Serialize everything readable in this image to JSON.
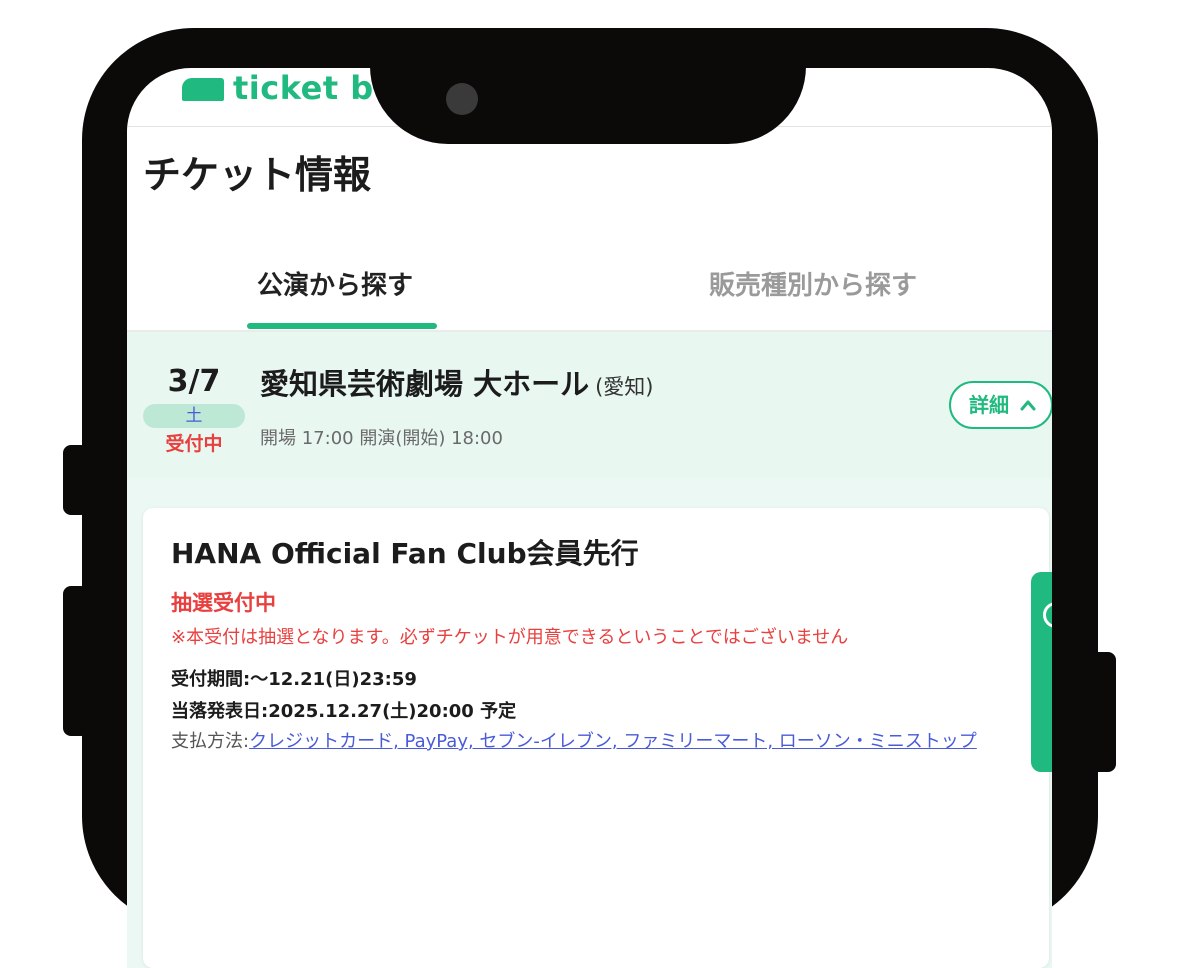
{
  "header": {
    "logo_text": "ticket board"
  },
  "page": {
    "title": "チケット情報"
  },
  "tabs": [
    {
      "label": "公演から探す",
      "active": true
    },
    {
      "label": "販売種別から探す",
      "active": false
    }
  ],
  "event": {
    "date": "3/7",
    "weekday": "土",
    "status": "受付中",
    "venue": "愛知県芸術劇場 大ホール",
    "prefecture": "(愛知)",
    "times": "開場 17:00 開演(開始) 18:00",
    "details_label": "詳細"
  },
  "sale": {
    "title": "HANA Official Fan Club会員先行",
    "status": "抽選受付中",
    "note": "※本受付は抽選となります。必ずチケットが用意できるということではございません",
    "period": "受付期間:〜12.21(日)23:59",
    "announcement": "当落発表日:2025.12.27(土)20:00 予定",
    "payment_label": "支払方法:",
    "payment_methods": "クレジットカード, PayPay, セブン-イレブン, ファミリーマート, ローソン・ミニストップ"
  },
  "colors": {
    "brand": "#20b97f",
    "alert": "#e8403f",
    "link": "#4a5bd8",
    "band": "#e9f7f1"
  },
  "icons": [
    "chevron-up-icon",
    "logo-mark-icon",
    "camera-icon"
  ]
}
